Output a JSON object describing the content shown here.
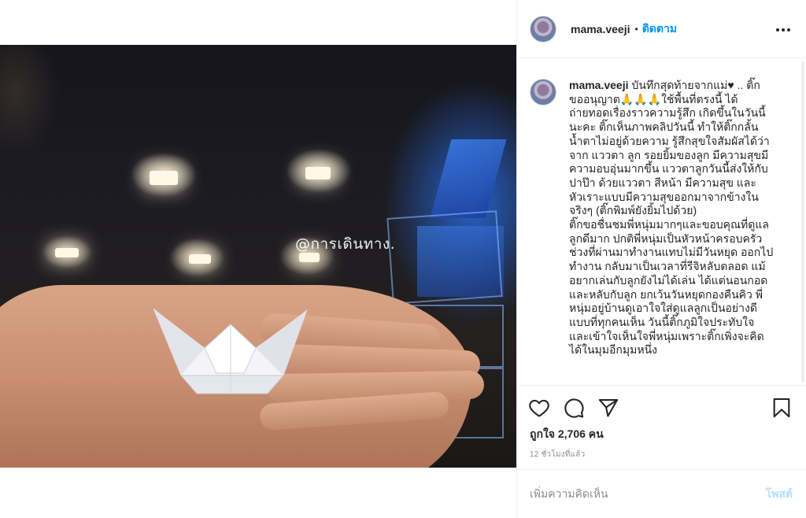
{
  "post": {
    "username": "mama.veeji",
    "follow_label": "ติดตาม",
    "header_separator": "•",
    "watermark": "@การเดินทาง.",
    "caption": {
      "author": "mama.veeji",
      "paragraph1": "บันทึกสุดท้ายจากแม่♥ .. ติ๊กขออนุญาต🙏🙏🙏ใช้พื้นที่ตรงนี้ ได้ถ่ายทอดเรื่องราวความรู้สึก เกิดขึ้นในวันนี้นะคะ ติ๊กเห็นภาพคลิปวันนี้ ทำให้ติ๊กกลั้นน้ำตาไม่อยู่ด้วยความ รู้สึกสุขใจสัมผัสได้ว่าจาก แววตา ลูก รอยยิ้มของลูก มีความสุขมีความอบอุ่นมากขึ้น แววตาลูกวันนี้ส่งให้กับปาป๊า ด้วยแววตา สีหน้า มีความสุข และหัวเราะแบบมีความสุขออกมาจากข้างในจริงๆ (ติ๊กพิมพ์ยังยิ้มไปด้วย)",
      "paragraph2": "ติ๊กขอชื่นชมพี่หนุ่มมากๆและขอบคุณที่ดูแลลูกดีมาก ปกติพี่หนุ่มเป็นหัวหน้าครอบครัว ช่วงที่ผ่านมาทำงานแทบไม่มีวันหยุด ออกไปทำงาน กลับมาเป็นเวลาที่รีจิหลับตลอด แม้อยากเล่นกับลูกยังไม่ได้เล่น ได้แต่นอนกอด และหลับกับลูก ยกเว้นวันหยุดกองคืนคิว พี่หนุ่มอยู่บ้านดูเอาใจใส่ดูแลลูกเป็นอย่างดีแบบที่ทุกคนเห็น วันนี้ติ๊กภูมิใจประทับใจและเข้าใจเห็นใจพี่หนุ่มเพราะติ๊กเพิ่งจะคิดได้ในมุมอีกมุมหนึ่ง"
    },
    "likes_text": "ถูกใจ 2,706 คน",
    "timestamp": "12 ชั่วโมงที่แล้ว",
    "comment_placeholder": "เพิ่มความคิดเห็น",
    "post_button": "โพสต์"
  },
  "icons": {
    "more": "more-horizontal-icon",
    "like": "heart-icon",
    "comment": "comment-bubble-icon",
    "share": "paper-plane-icon",
    "save": "bookmark-icon"
  },
  "colors": {
    "accent": "#0095f6",
    "post_disabled": "#b2dffc",
    "muted": "#8e8e8e",
    "text": "#262626"
  }
}
